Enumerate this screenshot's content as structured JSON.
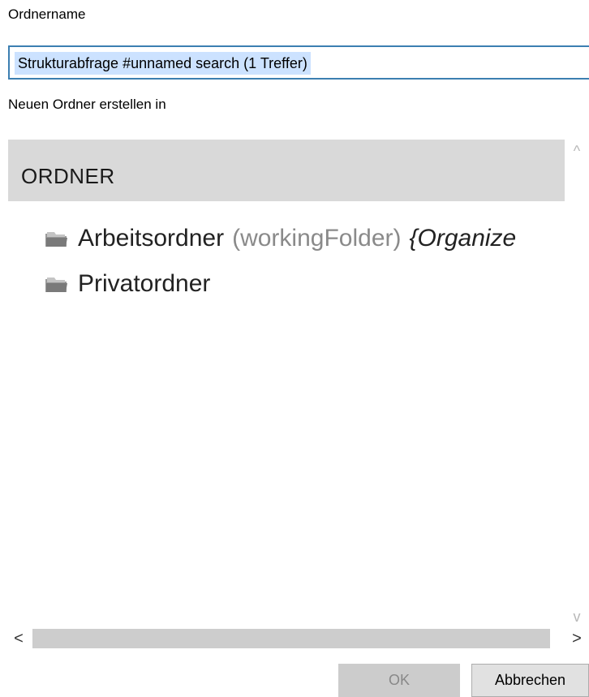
{
  "form": {
    "name_label": "Ordnername",
    "name_value": "Strukturabfrage #unnamed search (1 Treffer)",
    "create_in_label": "Neuen Ordner erstellen in"
  },
  "tree": {
    "header": "ORDNER",
    "items": [
      {
        "label": "Arbeitsordner",
        "sub": "(workingFolder)",
        "extra": "{Organize",
        "icon": "folder-icon"
      },
      {
        "label": "Privatordner",
        "icon": "folder-icon"
      }
    ]
  },
  "scrollbars": {
    "up": "^",
    "down": "v",
    "left": "<",
    "right": ">"
  },
  "buttons": {
    "ok": "OK",
    "cancel": "Abbrechen"
  },
  "colors": {
    "selection": "#cce2ff",
    "input_border": "#3c7fb1",
    "header_bg": "#d9d9d9"
  }
}
